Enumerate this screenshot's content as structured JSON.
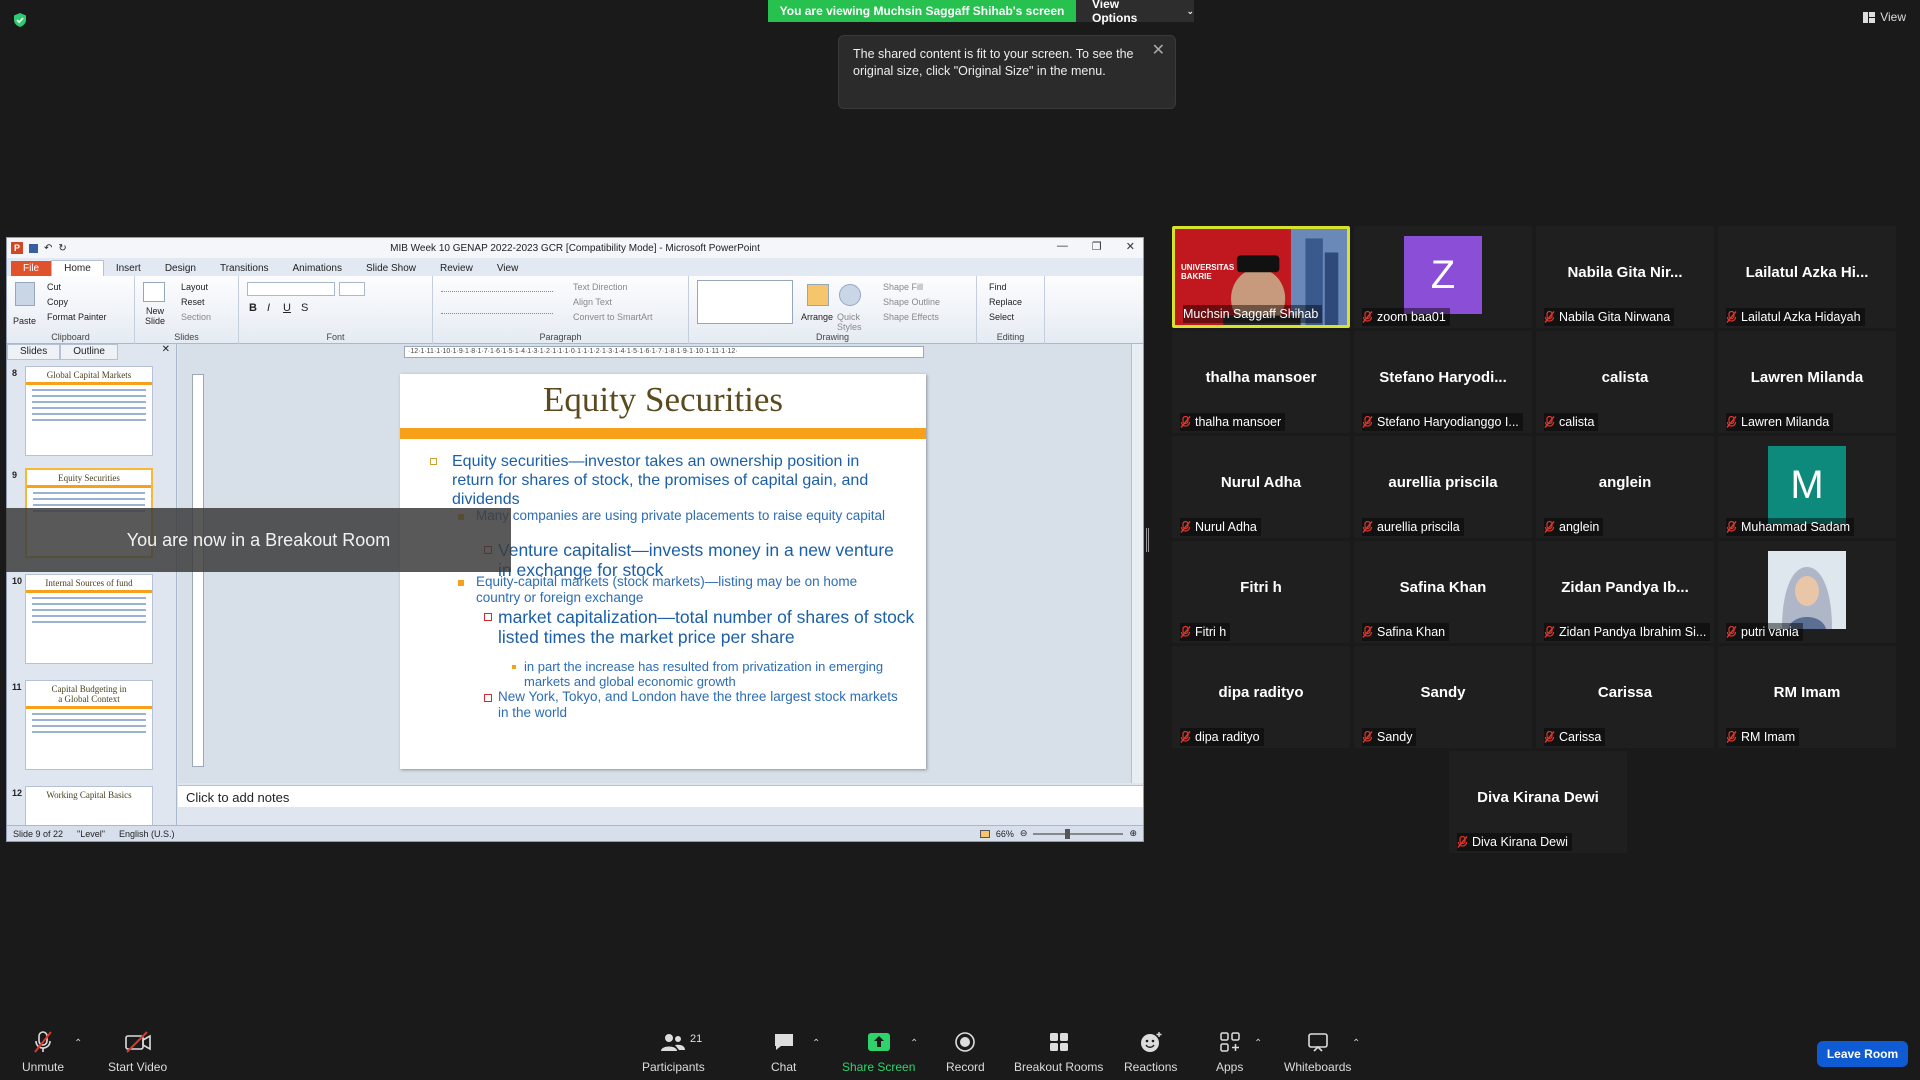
{
  "share_banner": {
    "viewing_text": "You are viewing Muchsin Saggaff Shihab's screen",
    "view_options_label": "View Options"
  },
  "view_button_label": "View",
  "tooltip": {
    "text": "The shared content is fit to your screen. To see the original size, click \"Original Size\" in the menu."
  },
  "breakout_message": "You are now in a Breakout Room",
  "ppt": {
    "window_title": "MIB Week 10 GENAP 2022-2023 GCR [Compatibility Mode] - Microsoft PowerPoint",
    "tabs": [
      "File",
      "Home",
      "Insert",
      "Design",
      "Transitions",
      "Animations",
      "Slide Show",
      "Review",
      "View"
    ],
    "ribbon": {
      "paste": "Paste",
      "cut": "Cut",
      "copy": "Copy",
      "format_painter": "Format Painter",
      "clipboard": "Clipboard",
      "new_slide": "New Slide",
      "layout": "Layout",
      "reset": "Reset",
      "section": "Section",
      "slides": "Slides",
      "font": "Font",
      "text_direction": "Text Direction",
      "align_text": "Align Text",
      "convert_smartart": "Convert to SmartArt",
      "paragraph": "Paragraph",
      "arrange": "Arrange",
      "quick_styles": "Quick Styles",
      "shape_fill": "Shape Fill",
      "shape_outline": "Shape Outline",
      "shape_effects": "Shape Effects",
      "drawing": "Drawing",
      "find": "Find",
      "replace": "Replace",
      "select": "Select",
      "editing": "Editing"
    },
    "pane_tabs": [
      "Slides",
      "Outline"
    ],
    "thumbnails": [
      {
        "num": "8",
        "title": "Global Capital Markets"
      },
      {
        "num": "9",
        "title": "Equity Securities"
      },
      {
        "num": "10",
        "title": "Internal Sources of fund"
      },
      {
        "num": "11",
        "title": "Capital Budgeting in a Global Context"
      },
      {
        "num": "12",
        "title": "Working Capital Basics"
      }
    ],
    "ruler_text": "·12·1·11·1·10·1·9·1·8·1·7·1·6·1·5·1·4·1·3·1·2·1·1·1·0·1·1·1·2·1·3·1·4·1·5·1·6·1·7·1·8·1·9·1·10·1·11·1·12·",
    "slide": {
      "title": "Equity Securities",
      "b1": "Equity securities—investor takes an ownership position in return for shares of stock, the promises of capital gain, and dividends",
      "b1a": "Many companies are using private placements to raise equity capital",
      "b1a1": "Venture capitalist—invests money in a new venture in exchange for stock",
      "b1b": "Equity-capital markets (stock markets)—listing may be on home country or foreign exchange",
      "b1b1": "market capitalization—total number of shares of stock listed times the market price per share",
      "b1b1a": "in part the increase has resulted from privatization in emerging markets and global economic growth",
      "b1b2": "New York, Tokyo, and London have the three largest stock markets in the world"
    },
    "notes_placeholder": "Click to add notes",
    "status": {
      "slide_of": "Slide 9 of 22",
      "theme": "\"Level\"",
      "language": "English (U.S.)",
      "zoom": "66%"
    }
  },
  "participants": [
    {
      "display": "",
      "name": "Muchsin Saggaff Shihab",
      "type": "video",
      "muted": false
    },
    {
      "display": "Z",
      "name": "zoom baa01",
      "type": "letter",
      "color": "#8a4fd6",
      "muted": true
    },
    {
      "display": "Nabila Gita Nir...",
      "name": "Nabila Gita Nirwana",
      "type": "text",
      "muted": true
    },
    {
      "display": "Lailatul Azka Hi...",
      "name": "Lailatul Azka Hidayah",
      "type": "text",
      "muted": true
    },
    {
      "display": "thalha mansoer",
      "name": "thalha mansoer",
      "type": "text",
      "muted": true
    },
    {
      "display": "Stefano  Haryodi...",
      "name": "Stefano Haryodianggo I...",
      "type": "text",
      "muted": true
    },
    {
      "display": "calista",
      "name": "calista",
      "type": "text",
      "muted": true
    },
    {
      "display": "Lawren Milanda",
      "name": "Lawren Milanda",
      "type": "text",
      "muted": true
    },
    {
      "display": "Nurul Adha",
      "name": "Nurul Adha",
      "type": "text",
      "muted": true
    },
    {
      "display": "aurellia priscila",
      "name": "aurellia priscila",
      "type": "text",
      "muted": true
    },
    {
      "display": "anglein",
      "name": "anglein",
      "type": "text",
      "muted": true
    },
    {
      "display": "M",
      "name": "Muhammad Sadam",
      "type": "letter",
      "color": "#0e8a7d",
      "muted": true
    },
    {
      "display": "Fitri h",
      "name": "Fitri h",
      "type": "text",
      "muted": true
    },
    {
      "display": "Safina Khan",
      "name": "Safina Khan",
      "type": "text",
      "muted": true
    },
    {
      "display": "Zidan  Pandya  Ib...",
      "name": "Zidan Pandya Ibrahim Si...",
      "type": "text",
      "muted": true
    },
    {
      "display": "",
      "name": "putri vania",
      "type": "photo",
      "muted": true
    },
    {
      "display": "dipa radityo",
      "name": "dipa radityo",
      "type": "text",
      "muted": true
    },
    {
      "display": "Sandy",
      "name": "Sandy",
      "type": "text",
      "muted": true
    },
    {
      "display": "Carissa",
      "name": "Carissa",
      "type": "text",
      "muted": true
    },
    {
      "display": "RM Imam",
      "name": "RM Imam",
      "type": "text",
      "muted": true
    },
    {
      "display": "Diva Kirana Dewi",
      "name": "Diva Kirana Dewi",
      "type": "text",
      "muted": true
    }
  ],
  "video_overlay_text": "UNIVERSITAS BAKRIE",
  "toolbar": {
    "unmute": "Unmute",
    "start_video": "Start Video",
    "participants": "Participants",
    "participants_count": "21",
    "chat": "Chat",
    "share_screen": "Share Screen",
    "record": "Record",
    "breakout_rooms": "Breakout Rooms",
    "reactions": "Reactions",
    "apps": "Apps",
    "whiteboards": "Whiteboards",
    "leave_room": "Leave Room"
  },
  "colors": {
    "banner_green": "#26c14f",
    "accent_orange": "#f7a11a",
    "active_speaker": "#d7e22a",
    "leave_blue": "#0e5bd3"
  }
}
